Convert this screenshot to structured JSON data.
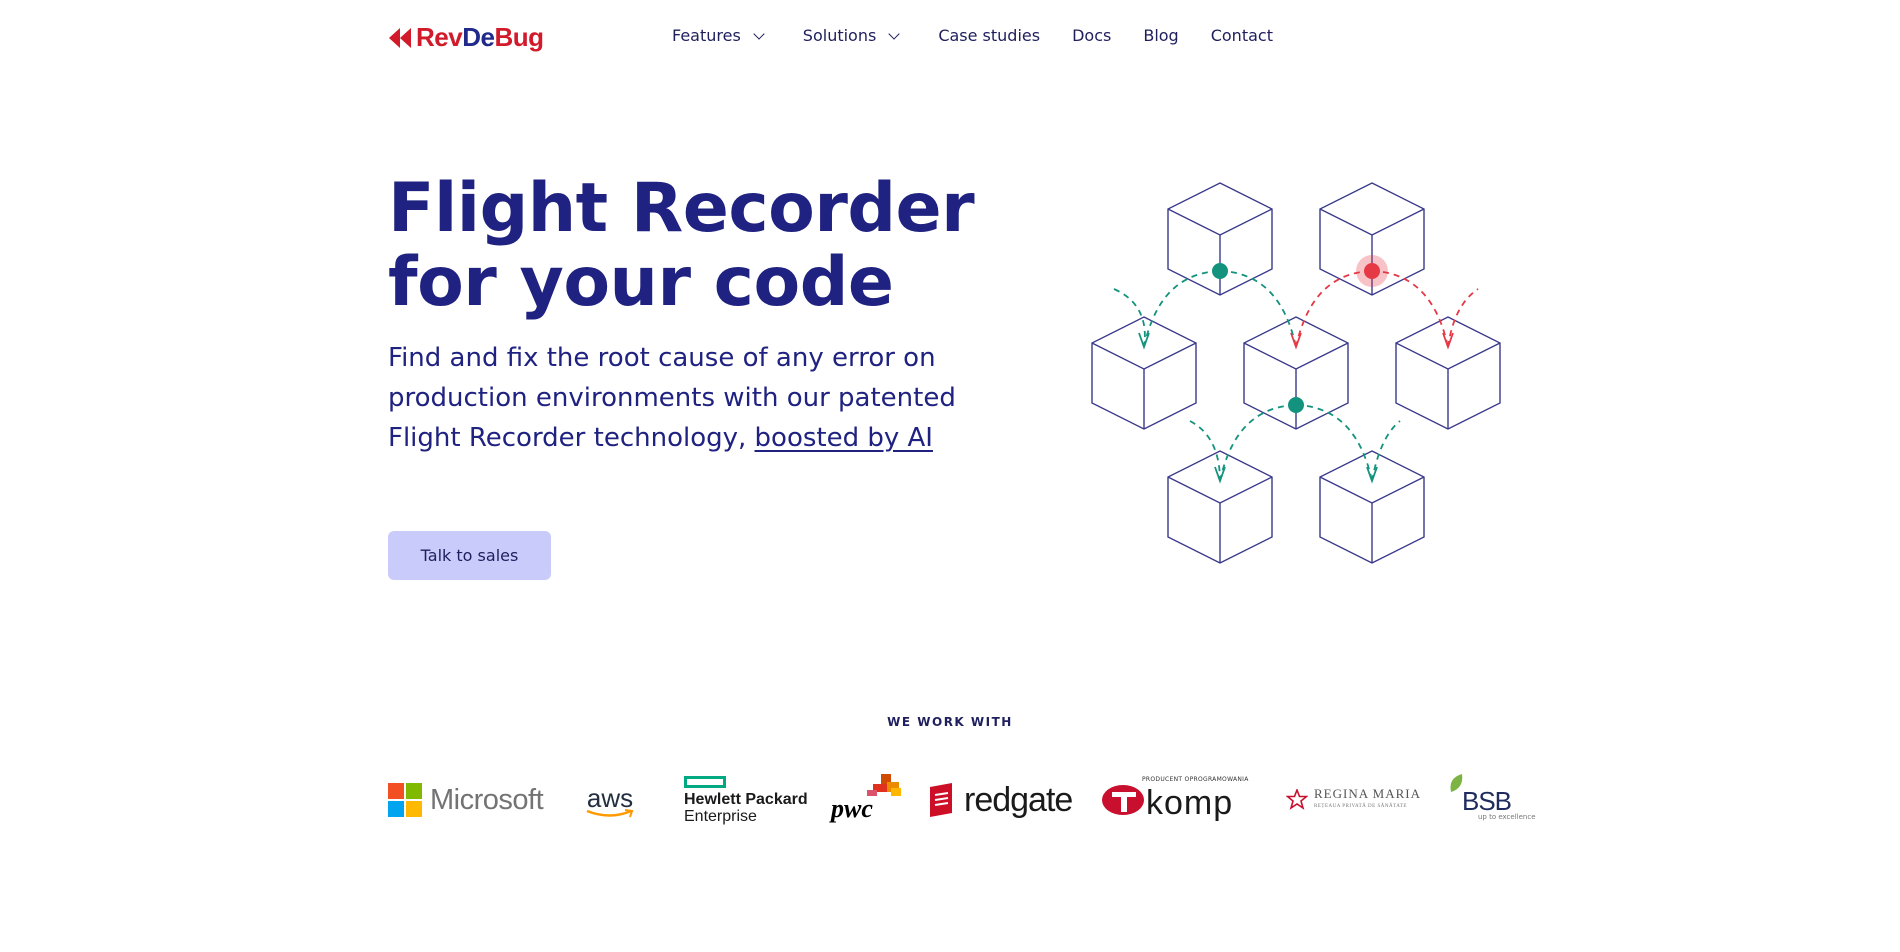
{
  "brand": {
    "part1": "Rev",
    "part2": "De",
    "part3": "Bug",
    "colors": {
      "red": "#d11a2a",
      "navy": "#1f2a8a"
    }
  },
  "nav": {
    "items": [
      {
        "label": "Features",
        "has_dropdown": true
      },
      {
        "label": "Solutions",
        "has_dropdown": true
      },
      {
        "label": "Case studies",
        "has_dropdown": false
      },
      {
        "label": "Docs",
        "has_dropdown": false
      },
      {
        "label": "Blog",
        "has_dropdown": false
      },
      {
        "label": "Contact",
        "has_dropdown": false
      }
    ]
  },
  "hero": {
    "title_line1": "Flight Recorder",
    "title_line2": "for your code",
    "subtitle": "Find and fix the root cause of any error on production environments with our patented Flight Recorder technology,",
    "subtitle_link": "boosted by AI",
    "cta_label": "Talk to sales",
    "colors": {
      "title": "#1f2280",
      "cta_bg": "#c9ccfb",
      "teal": "#13937d",
      "red": "#e63946",
      "cube_stroke": "#3a3a8c"
    }
  },
  "partners": {
    "label": "WE WORK WITH",
    "logos": [
      {
        "name": "Microsoft",
        "text": "Microsoft"
      },
      {
        "name": "AWS",
        "text": "aws"
      },
      {
        "name": "Hewlett Packard Enterprise",
        "line1": "Hewlett Packard",
        "line2": "Enterprise"
      },
      {
        "name": "PwC",
        "text": "pwc"
      },
      {
        "name": "Redgate",
        "text": "redgate"
      },
      {
        "name": "Komp",
        "text": "komp",
        "small": "PRODUCENT OPROGRAMOWANIA"
      },
      {
        "name": "Regina Maria",
        "text": "REGINA MARIA",
        "small": "REȚEAUA PRIVATĂ DE SĂNĂTATE"
      },
      {
        "name": "BSB",
        "text": "BSB",
        "small": "up to excellence"
      }
    ]
  }
}
